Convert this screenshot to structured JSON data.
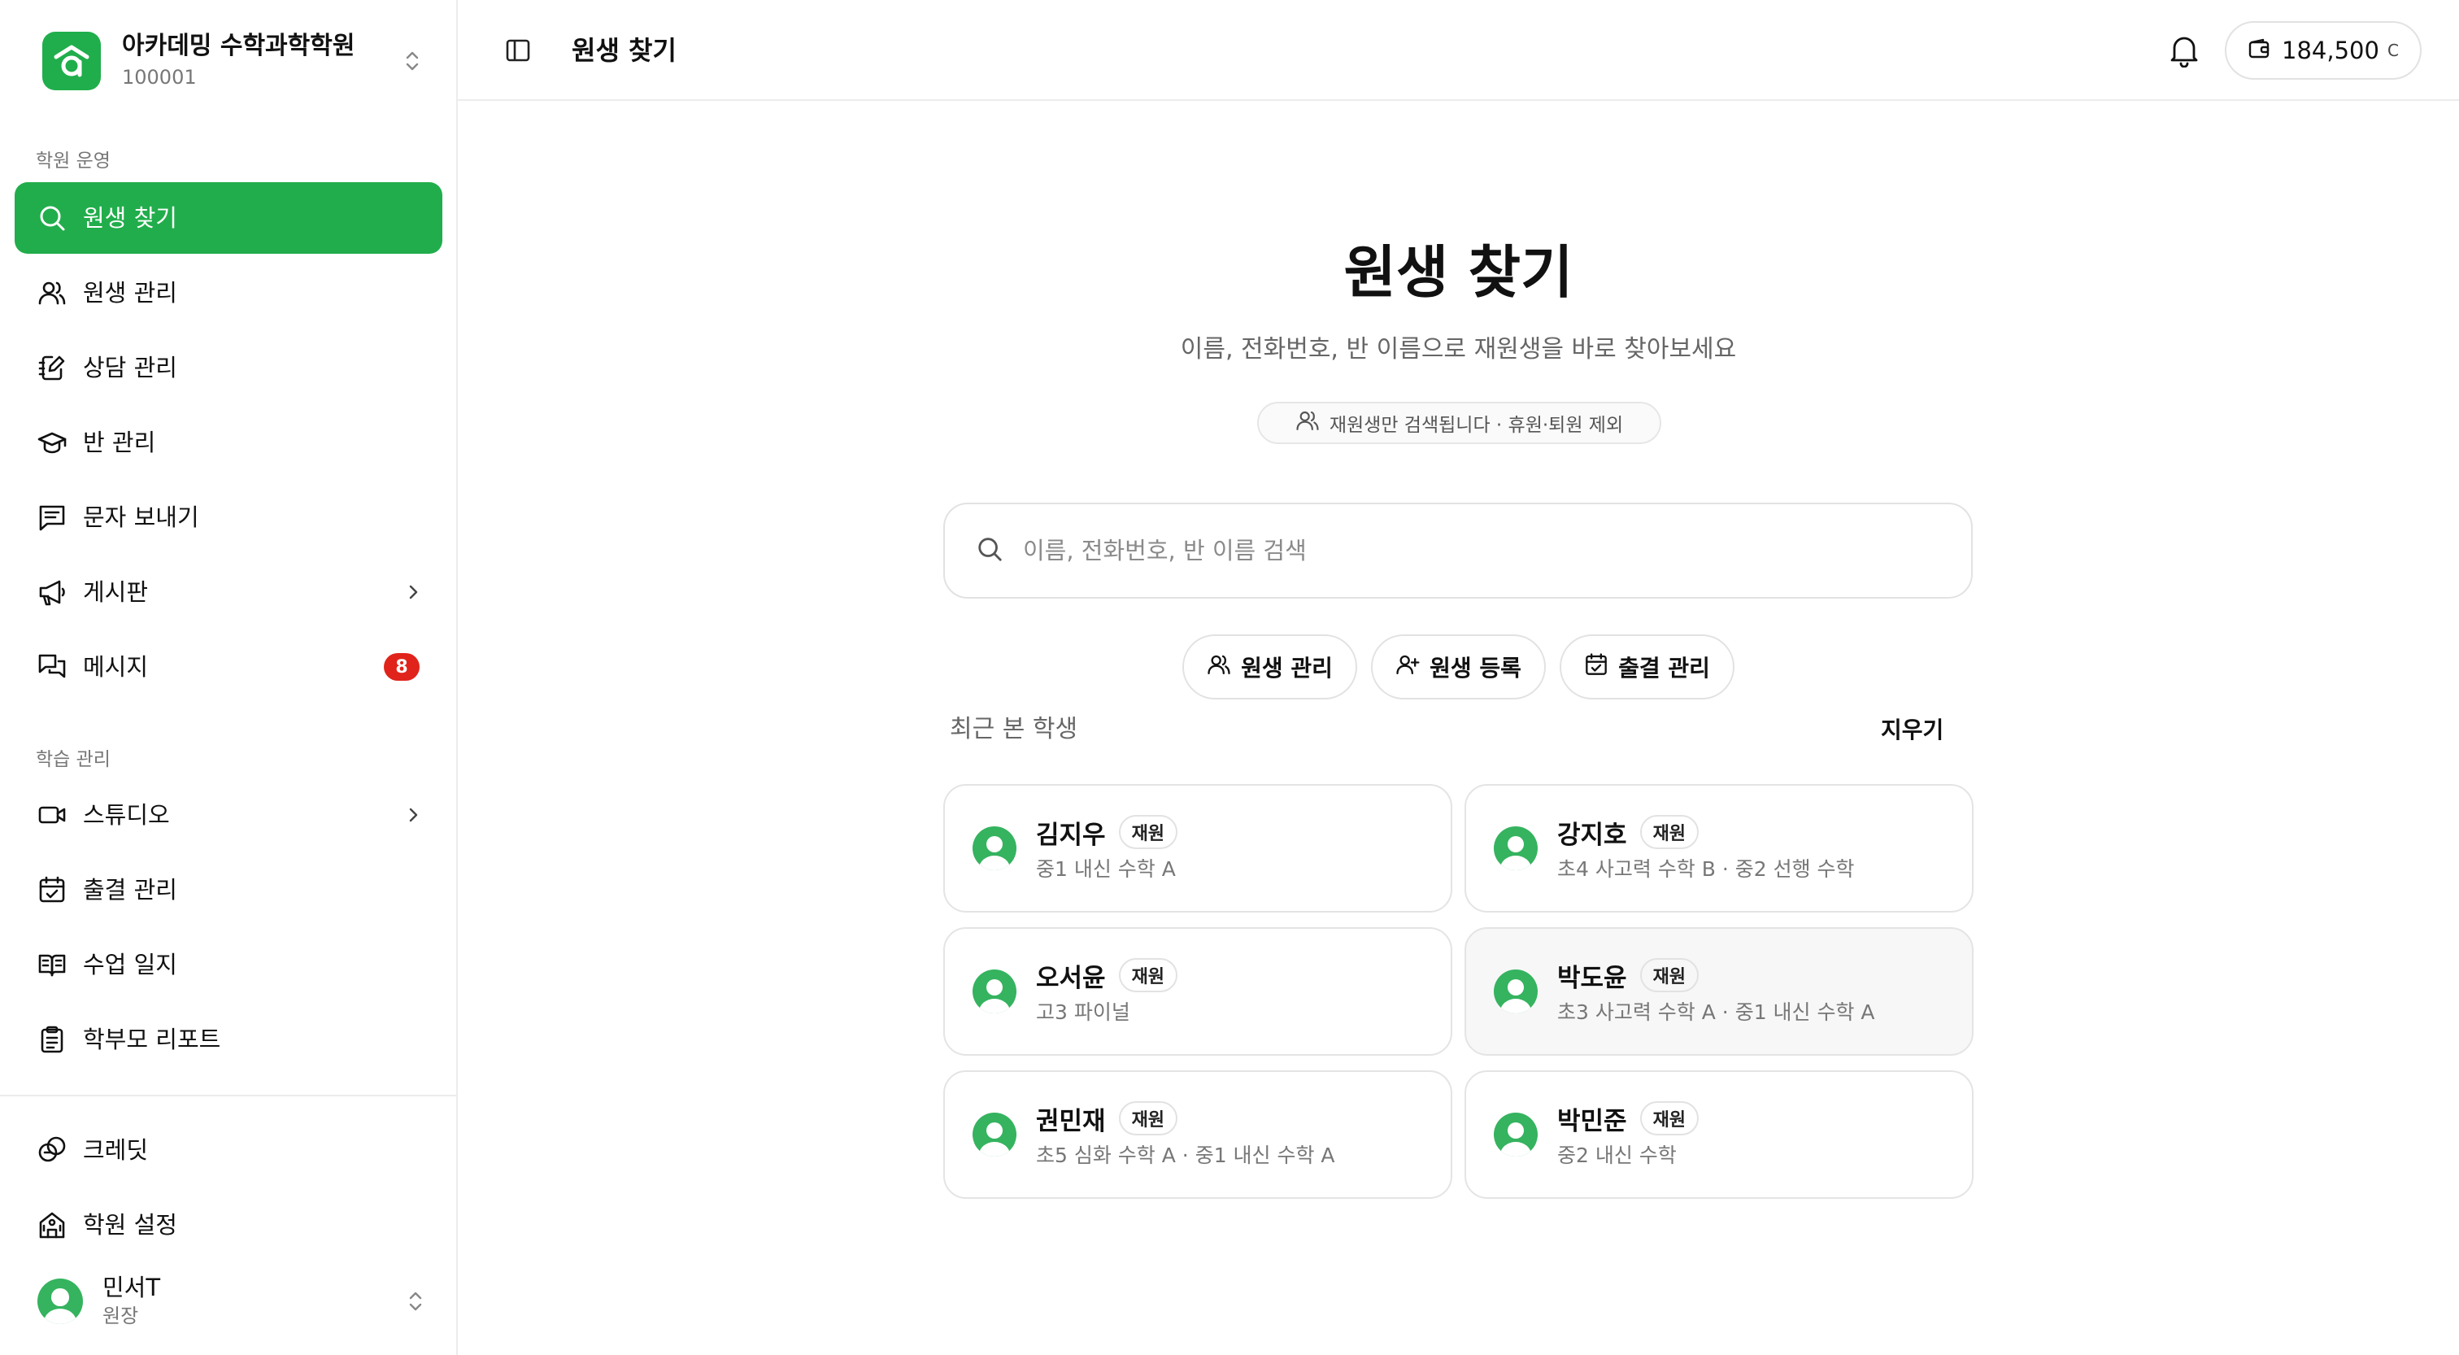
{
  "brand": {
    "name": "아카데밍 수학과학학원",
    "code": "100001"
  },
  "sidebar": {
    "section_ops": "학원 운영",
    "section_learning": "학습 관리",
    "items": [
      {
        "label": "원생 찾기",
        "icon": "search-icon"
      },
      {
        "label": "원생 관리",
        "icon": "users-icon"
      },
      {
        "label": "상담 관리",
        "icon": "notebook-pen-icon"
      },
      {
        "label": "반 관리",
        "icon": "graduation-cap-icon"
      },
      {
        "label": "문자 보내기",
        "icon": "message-square-text-icon"
      },
      {
        "label": "게시판",
        "icon": "megaphone-icon"
      },
      {
        "label": "메시지",
        "icon": "messages-icon",
        "badge": "8"
      },
      {
        "label": "스튜디오",
        "icon": "video-icon"
      },
      {
        "label": "출결 관리",
        "icon": "calendar-check-icon"
      },
      {
        "label": "수업 일지",
        "icon": "book-open-icon"
      },
      {
        "label": "학부모 리포트",
        "icon": "clipboard-list-icon"
      }
    ],
    "footer": [
      {
        "label": "크레딧",
        "icon": "coins-icon"
      },
      {
        "label": "학원 설정",
        "icon": "building-icon"
      }
    ],
    "user": {
      "name": "민서T",
      "role": "원장"
    }
  },
  "topbar": {
    "title": "원생 찾기",
    "credit_value": "184,500",
    "credit_unit": "C"
  },
  "hero": {
    "title": "원생 찾기",
    "subtitle": "이름, 전화번호, 반 이름으로 재원생을 바로 찾아보세요",
    "notice": "재원생만 검색됩니다 · 휴원·퇴원 제외"
  },
  "search": {
    "placeholder": "이름, 전화번호, 반 이름 검색",
    "value": ""
  },
  "quick_actions": [
    {
      "label": "원생 관리",
      "icon": "users-icon"
    },
    {
      "label": "원생 등록",
      "icon": "user-plus-icon"
    },
    {
      "label": "출결 관리",
      "icon": "calendar-check-icon"
    }
  ],
  "recent": {
    "label": "최근 본 학생",
    "clear": "지우기",
    "students": [
      {
        "name": "김지우",
        "status": "재원",
        "classes": "중1 내신 수학 A"
      },
      {
        "name": "강지호",
        "status": "재원",
        "classes": "초4 사고력 수학 B · 중2 선행 수학"
      },
      {
        "name": "오서윤",
        "status": "재원",
        "classes": "고3 파이널"
      },
      {
        "name": "박도윤",
        "status": "재원",
        "classes": "초3 사고력 수학 A · 중1 내신 수학 A"
      },
      {
        "name": "권민재",
        "status": "재원",
        "classes": "초5 심화 수학 A · 중1 내신 수학 A"
      },
      {
        "name": "박민준",
        "status": "재원",
        "classes": "중2 내신 수학"
      }
    ]
  },
  "colors": {
    "brand": "#21ad4b",
    "avatar": "#35b35f",
    "badge": "#e0241b"
  }
}
